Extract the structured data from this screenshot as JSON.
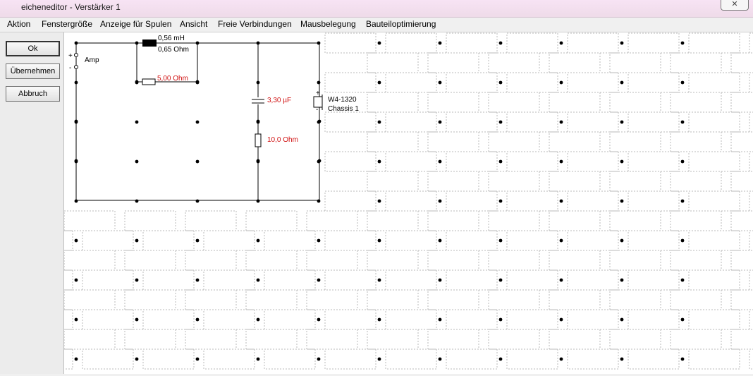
{
  "window": {
    "title": "eicheneditor - Verstärker 1",
    "close_glyph": "✕"
  },
  "menu": [
    "Aktion",
    "Fenstergröße",
    "Anzeige für Spulen",
    "Ansicht",
    "Freie Verbindungen",
    "Mausbelegung",
    "Bauteiloptimierung"
  ],
  "buttons": {
    "ok": "Ok",
    "apply": "Übernehmen",
    "cancel": "Abbruch"
  },
  "circuit": {
    "amp_label": "Amp",
    "plus": "+",
    "minus": "-",
    "inductor_value": "0,56 mH",
    "inductor_resistance": "0,65 Ohm",
    "parallel_resistor": "5,00 Ohm",
    "capacitor": "3,30 µF",
    "series_resistor": "10,0 Ohm",
    "driver_model": "W4-1320",
    "driver_name": "Chassis 1"
  },
  "colors": {
    "value_red": "#d01010",
    "grid_dash": "#b8b8b8"
  }
}
